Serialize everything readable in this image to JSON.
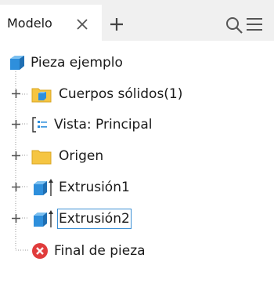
{
  "panel": {
    "tab_label": "Modelo",
    "icons": [
      "close-icon",
      "add-icon",
      "search-icon",
      "menu-icon"
    ]
  },
  "tree": {
    "root": {
      "label": "Pieza ejemplo",
      "icon": "part-cube-icon"
    },
    "items": [
      {
        "label": "Cuerpos sólidos(1)",
        "icon": "solid-bodies-folder-icon",
        "expandable": true,
        "selected": false
      },
      {
        "label": "Vista: Principal",
        "icon": "view-rep-icon",
        "expandable": true,
        "selected": false
      },
      {
        "label": "Origen",
        "icon": "folder-icon",
        "expandable": true,
        "selected": false
      },
      {
        "label": "Extrusión1",
        "icon": "extrusion-icon",
        "expandable": true,
        "selected": false
      },
      {
        "label": "Extrusión2",
        "icon": "extrusion-icon",
        "expandable": true,
        "selected": true
      },
      {
        "label": "Final de pieza",
        "icon": "end-of-part-icon",
        "expandable": false,
        "selected": false
      }
    ]
  },
  "colors": {
    "accent_blue": "#2e8fdc",
    "folder_yellow": "#f5c542",
    "end_of_part_red": "#e03c3c",
    "selection_outline": "#3c8fd4"
  }
}
